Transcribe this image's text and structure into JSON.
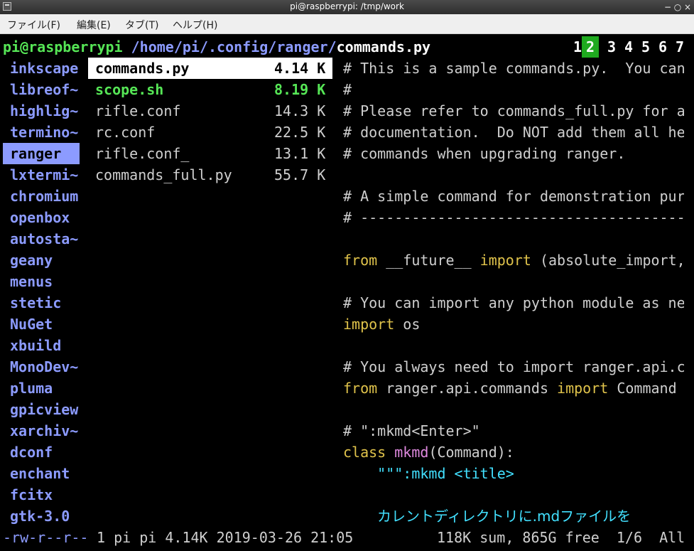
{
  "window": {
    "title": "pi@raspberrypi: /tmp/work",
    "controls": [
      "−",
      "○",
      "×"
    ]
  },
  "menu": [
    "ファイル(F)",
    "編集(E)",
    "タブ(T)",
    "ヘルプ(H)"
  ],
  "header": {
    "host": "pi@raspberrypi",
    "path": "/home/pi/.config/ranger/",
    "file": "commands.py",
    "tabs": [
      "1",
      "2",
      "3",
      "4",
      "5",
      "6",
      "7"
    ],
    "active_tab": "2"
  },
  "parent_dirs": [
    "inkscape",
    "libreof~",
    "highlig~",
    "termino~",
    "ranger",
    "lxtermi~",
    "chromium",
    "openbox",
    "autosta~",
    "geany",
    "menus",
    "stetic",
    "NuGet",
    "xbuild",
    "MonoDev~",
    "pluma",
    "gpicview",
    "xarchiv~",
    "dconf",
    "enchant",
    "fcitx",
    "gtk-3.0"
  ],
  "selected_parent": "ranger",
  "files": [
    {
      "name": "commands.py",
      "size": "4.14 K"
    },
    {
      "name": "scope.sh",
      "size": "8.19 K"
    },
    {
      "name": "rifle.conf",
      "size": "14.3 K"
    },
    {
      "name": "rc.conf",
      "size": "22.5 K"
    },
    {
      "name": "rifle.conf_",
      "size": "13.1 K"
    },
    {
      "name": "commands_full.py",
      "size": "55.7 K"
    }
  ],
  "preview": [
    "# This is a sample commands.py.  You can",
    "#",
    "# Please refer to commands_full.py for a",
    "# documentation.  Do NOT add them all he",
    "# commands when upgrading ranger.",
    "",
    "# A simple command for demonstration pur",
    "# ---------------------------------------",
    "",
    "from __future__ import (absolute_import,",
    "",
    "# You can import any python module as ne",
    "import os",
    "",
    "# You always need to import ranger.api.c",
    "from ranger.api.commands import Command",
    "",
    "# \":mkmd<Enter>\"",
    "class mkmd(Command):",
    "    \"\"\":mkmd <title>",
    "",
    ""
  ],
  "preview_jp": "カレントディレクトリに.mdファイルを",
  "status": {
    "perms": "-rw-r--r--",
    "info": " 1 pi pi 4.14K 2019-03-26 21:05",
    "summary": "118K sum, 865G free  1/6  All"
  }
}
